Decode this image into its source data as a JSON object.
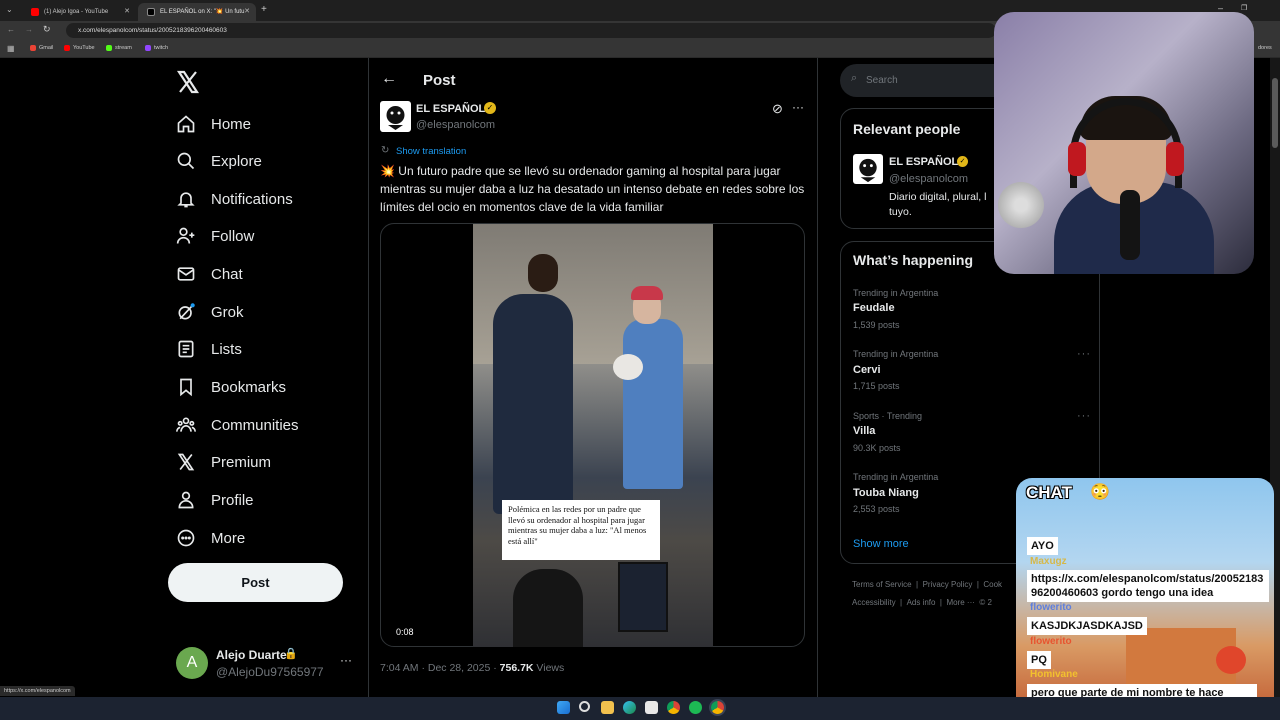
{
  "browser": {
    "tabs": [
      {
        "label": "(1) Alejo Igoa - YouTube",
        "color": "#ff0000"
      },
      {
        "label": "EL ESPAÑOL on X: \"💥 Un futu",
        "color": "#111111"
      }
    ],
    "url": "x.com/elespanolcom/status/2005218396200460603",
    "bookmarks": [
      {
        "label": "Gmail",
        "color": "#ea4335"
      },
      {
        "label": "YouTube",
        "color": "#ff0000"
      },
      {
        "label": "stream",
        "color": "#53fc18"
      },
      {
        "label": "twitch",
        "color": "#9146ff"
      }
    ],
    "all_bookmarks": "dores",
    "status_url": "https://x.com/elespanolcom"
  },
  "nav": {
    "items": [
      "Home",
      "Explore",
      "Notifications",
      "Follow",
      "Chat",
      "Grok",
      "Lists",
      "Bookmarks",
      "Communities",
      "Premium",
      "Profile",
      "More"
    ],
    "post_button": "Post",
    "account_name": "Alejo Duarte",
    "account_handle": "@AlejoDu97565977",
    "account_initial": "A",
    "more_dots": "···"
  },
  "post": {
    "header": "Post",
    "author": "EL ESPAÑOL",
    "handle": "@elespanolcom",
    "show_translation": "Show translation",
    "text": "💥 Un futuro padre que se llevó su ordenador gaming al hospital para jugar mientras su mujer daba a luz ha desatado un intenso debate en redes sobre los límites del ocio en momentos clave de la vida familiar",
    "video_caption": "Polémica en las redes por un padre que llevó su ordenador al hospital para jugar mientras su mujer daba a luz: \"Al menos está allí\"",
    "video_time": "0:08",
    "timestamp": "7:04 AM · Dec 28, 2025 · ",
    "views_count": "756.7K",
    "views_label": " Views"
  },
  "search": {
    "placeholder": "Search"
  },
  "relevant": {
    "heading": "Relevant people",
    "name": "EL ESPAÑOL",
    "handle": "@elespanolcom",
    "bio_line1": "Diario digital, plural, l",
    "bio_line2": "tuyo."
  },
  "happening": {
    "heading": "What’s happening",
    "trends": [
      {
        "meta": "Trending in Argentina",
        "title": "Feudale",
        "count": "1,539 posts"
      },
      {
        "meta": "Trending in Argentina",
        "title": "Cervi",
        "count": "1,715 posts"
      },
      {
        "meta": "Sports · Trending",
        "title": "Villa",
        "count": "90.3K posts"
      },
      {
        "meta": "Trending in Argentina",
        "title": "Touba Niang",
        "count": "2,553 posts"
      }
    ],
    "show_more": "Show more"
  },
  "footer": {
    "links1": [
      "Terms of Service",
      "|",
      "Privacy Policy",
      "|",
      "Cook"
    ],
    "links2": [
      "Accessibility",
      "|",
      "Ads info",
      "|",
      "More ···",
      "© 2"
    ]
  },
  "chat": {
    "title": "CHAT",
    "messages": [
      {
        "nick": "",
        "text": "AYO"
      },
      {
        "nick": "Maxugz",
        "text": "https://x.com/elespanolcom/status/2005218396200460603 gordo tengo una idea"
      },
      {
        "nick": "flowerito",
        "text": "KASJDKJASDKAJSD"
      },
      {
        "nick": "flowerito",
        "text": "PQ"
      },
      {
        "nick": "Homivane",
        "text": "pero que parte de mi nombre te hace pensar que soy pibe?"
      }
    ]
  },
  "colors": {
    "accent": "#1d9bf0",
    "verified": "#e2b719",
    "bg": "#000000"
  }
}
